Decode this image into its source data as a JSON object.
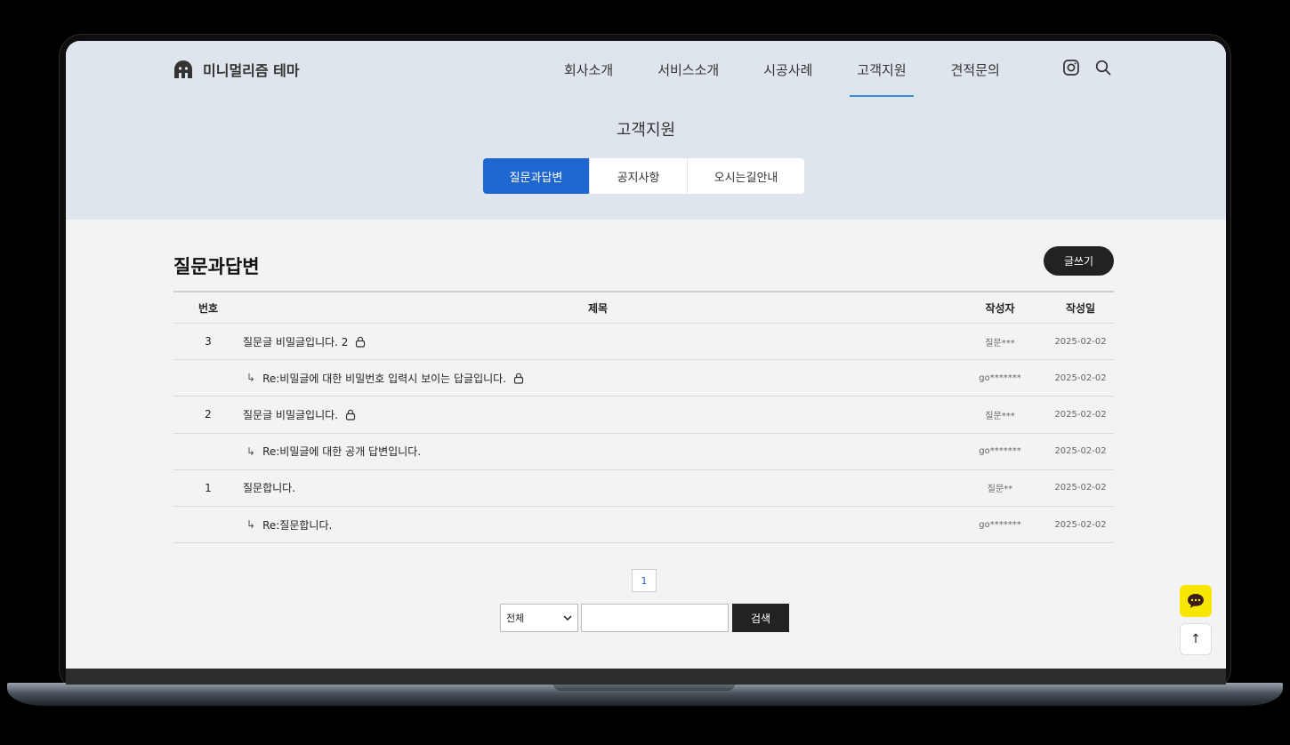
{
  "header": {
    "logo_text": "미니멀리즘 테마",
    "nav": [
      "회사소개",
      "서비스소개",
      "시공사례",
      "고객지원",
      "견적문의"
    ],
    "active_nav": "고객지원"
  },
  "hero": {
    "title": "고객지원",
    "tabs": [
      "질문과답변",
      "공지사항",
      "오시는길안내"
    ],
    "active_tab": "질문과답변"
  },
  "board": {
    "title": "질문과답변",
    "write_label": "글쓰기",
    "columns": {
      "num": "번호",
      "title": "제목",
      "writer": "작성자",
      "date": "작성일"
    },
    "rows": [
      {
        "num": "3",
        "title": "질문글 비밀글입니다. 2",
        "locked": true,
        "reply": false,
        "writer": "질문***",
        "date": "2025-02-02"
      },
      {
        "num": "",
        "title": "Re:비밀글에 대한 비밀번호 입력시 보이는 답글입니다.",
        "locked": true,
        "reply": true,
        "writer": "go*******",
        "date": "2025-02-02"
      },
      {
        "num": "2",
        "title": "질문글 비밀글입니다.",
        "locked": true,
        "reply": false,
        "writer": "질문***",
        "date": "2025-02-02"
      },
      {
        "num": "",
        "title": "Re:비밀글에 대한 공개 답변입니다.",
        "locked": false,
        "reply": true,
        "writer": "go*******",
        "date": "2025-02-02"
      },
      {
        "num": "1",
        "title": "질문합니다.",
        "locked": false,
        "reply": false,
        "writer": "질문**",
        "date": "2025-02-02"
      },
      {
        "num": "",
        "title": "Re:질문합니다.",
        "locked": false,
        "reply": true,
        "writer": "go*******",
        "date": "2025-02-02"
      }
    ]
  },
  "pagination": {
    "current": "1"
  },
  "search": {
    "scope": "전체",
    "button": "검색",
    "query": ""
  },
  "floating": {
    "top_arrow": "↑"
  },
  "colors": {
    "accent": "#1f66d1",
    "hero_bg": "#dfe5ec",
    "chat": "#f7e600"
  }
}
